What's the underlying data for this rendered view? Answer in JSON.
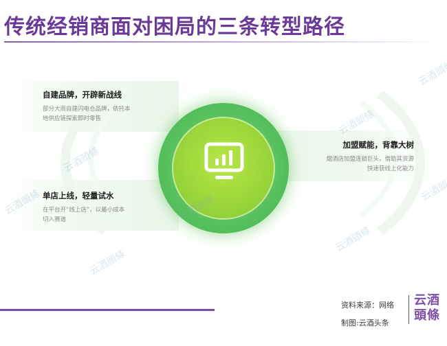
{
  "title": "传统经销商面对困局的三条转型路径",
  "center_icon": "monitor-chart-icon",
  "paths": [
    {
      "heading": "自建品牌，开辟新战线",
      "desc_line1": "部分大商自建闪电仓品牌，依托本",
      "desc_line2": "地供应链探索即时零售"
    },
    {
      "heading": "单店上线，轻量试水",
      "desc_line1": "在平台开“线上店”，以最小成本",
      "desc_line2": "切入赛道"
    },
    {
      "heading": "加盟赋能，背靠大树",
      "desc_line1": "烟酒店加盟连锁巨头，借助其资源",
      "desc_line2": "快速获线上化能力"
    }
  ],
  "watermark": "云酒頭條",
  "footer": {
    "source": "资料来源：网络",
    "made_by": "制图:云酒头条",
    "logo_line1": "云酒",
    "logo_line2": "頭條"
  },
  "colors": {
    "title": "#6a3a96",
    "accent_green": "#5cc35e",
    "core_green": "#9fd83a",
    "logo": "#7d4ea8"
  }
}
